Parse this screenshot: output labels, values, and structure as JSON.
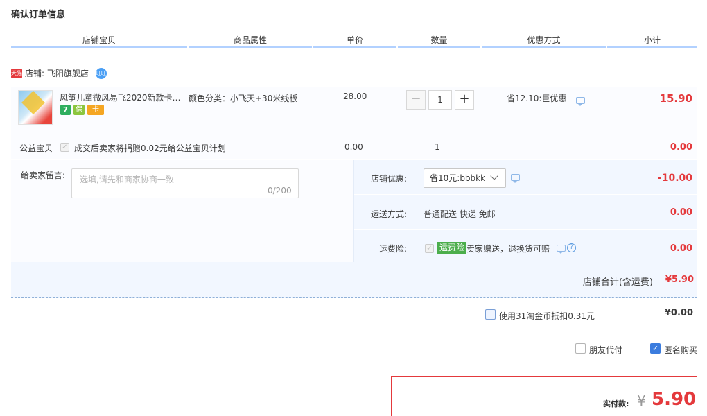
{
  "page": {
    "title": "确认订单信息"
  },
  "columns": [
    "店铺宝贝",
    "商品属性",
    "单价",
    "数量",
    "优惠方式",
    "小计"
  ],
  "shop": {
    "badge": "天猫",
    "label": "店铺: 飞阳旗舰店",
    "ww": "旺旺"
  },
  "item": {
    "title": "风筝儿童微风易飞2020新款卡…",
    "attr": "颜色分类：小飞天+30米线板",
    "price": "28.00",
    "qty_minus": "−",
    "qty": "1",
    "qty_plus": "+",
    "promo": "省12.10:巨优惠",
    "subtotal": "15.90",
    "service_icons": [
      "7",
      "保",
      "卡"
    ]
  },
  "charity": {
    "label": "公益宝贝",
    "text": "成交后卖家将捐赠0.02元给公益宝贝计划",
    "price": "0.00",
    "qty": "1",
    "subtotal": "0.00"
  },
  "note": {
    "label": "给卖家留言:",
    "placeholder": "选填,请先和商家协商一致",
    "count": "0/200"
  },
  "shop_discount": {
    "label": "店铺优惠:",
    "selected": "省10元:bbbkk",
    "value": "-10.00"
  },
  "shipping": {
    "label": "运送方式:",
    "value": "普通配送 快递 免邮",
    "price": "0.00"
  },
  "insurance": {
    "label": "运费险:",
    "tag": "运费险",
    "text": "卖家赠送，退换货可赔",
    "price": "0.00"
  },
  "shop_total": {
    "label": "店铺合计(含运费)",
    "value": "¥5.90"
  },
  "coin": {
    "text": "使用31淘金币抵扣0.31元",
    "value": "¥0.00"
  },
  "friend_pay": {
    "label": "朋友代付"
  },
  "anonymous": {
    "label": "匿名购买",
    "checked": true
  },
  "payment": {
    "label": "实付款:",
    "currency": "¥",
    "value": "5.90"
  },
  "colors": {
    "accent_red": "#e4393c",
    "header_line": "#b2d1ff",
    "panel_bg": "#f2f7ff",
    "check_blue": "#3b7cde",
    "insurance_green": "#4cae4c"
  }
}
